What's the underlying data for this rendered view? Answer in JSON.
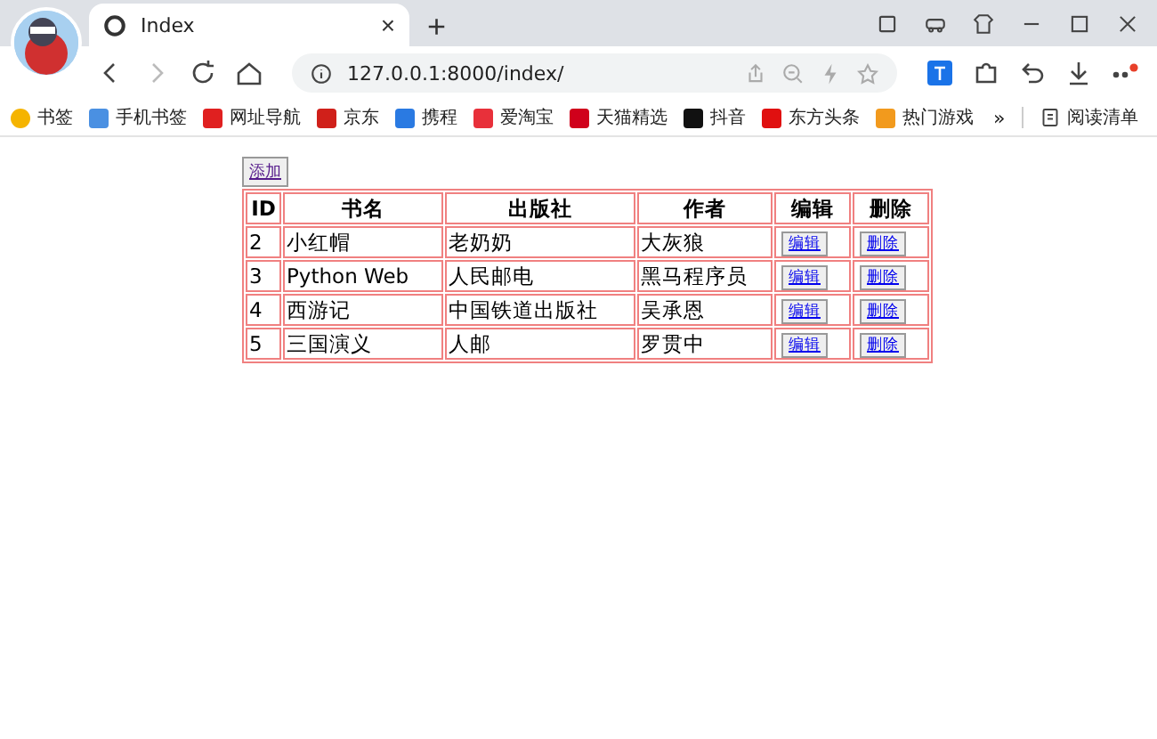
{
  "tab": {
    "title": "Index",
    "close": "×"
  },
  "new_tab": "+",
  "address": {
    "url": "127.0.0.1:8000/index/"
  },
  "bookmarks": [
    {
      "label": "书签",
      "color": "#f5b400"
    },
    {
      "label": "手机书签",
      "color": "#4a90e2"
    },
    {
      "label": "网址导航",
      "color": "#e02020"
    },
    {
      "label": "京东",
      "color": "#d0201a"
    },
    {
      "label": "携程",
      "color": "#2a7ae2"
    },
    {
      "label": "爱淘宝",
      "color": "#e8303a"
    },
    {
      "label": "天猫精选",
      "color": "#d0001b"
    },
    {
      "label": "抖音",
      "color": "#111111"
    },
    {
      "label": "东方头条",
      "color": "#e01010"
    },
    {
      "label": "热门游戏",
      "color": "#f29a1d"
    }
  ],
  "more": "»",
  "reading_list": "阅读清单",
  "add_button": "添加",
  "table": {
    "columns": [
      "ID",
      "书名",
      "出版社",
      "作者",
      "编辑",
      "删除"
    ],
    "rows": [
      {
        "id": "2",
        "title": "小红帽",
        "publisher": "老奶奶",
        "author": "大灰狼",
        "edit": "编辑",
        "delete": "删除"
      },
      {
        "id": "3",
        "title": "Python Web",
        "publisher": "人民邮电",
        "author": "黑马程序员",
        "edit": "编辑",
        "delete": "删除"
      },
      {
        "id": "4",
        "title": "西游记",
        "publisher": "中国铁道出版社",
        "author": "吴承恩",
        "edit": "编辑",
        "delete": "删除"
      },
      {
        "id": "5",
        "title": "三国演义",
        "publisher": "人邮",
        "author": "罗贯中",
        "edit": "编辑",
        "delete": "删除"
      }
    ]
  }
}
